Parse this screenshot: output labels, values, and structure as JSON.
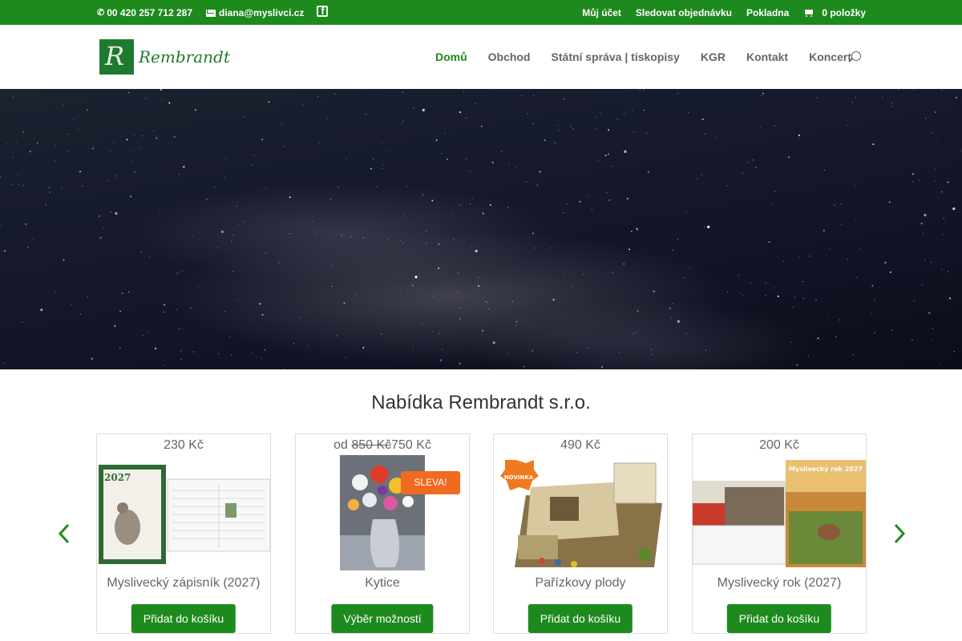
{
  "topbar": {
    "phone": "00 420 257 712 287",
    "email": "diana@myslivci.cz",
    "links": [
      "Můj účet",
      "Sledovat objednávku",
      "Pokladna"
    ],
    "cart": "0 položky"
  },
  "header": {
    "logo_text": "Rembrandt",
    "nav": [
      "Domů",
      "Obchod",
      "Státní správa | tiskopisy",
      "KGR",
      "Kontakt",
      "Koncert"
    ]
  },
  "section": {
    "title": "Nabídka Rembrandt s.r.o."
  },
  "products": [
    {
      "price": "230 Kč",
      "name": "Myslivecký zápisník (2027)",
      "button": "Přidat do košíku",
      "image": "notebook-calendar-image",
      "cover_year": "2027"
    },
    {
      "price_prefix": "od ",
      "price_old": "850 Kč",
      "price_new": "750 Kč",
      "name": "Kytice",
      "button": "Výběr možností",
      "badge": "SLEVA!",
      "image": "flower-painting-image"
    },
    {
      "price": "490 Kč",
      "name": "Pařízkovy plody",
      "button": "Přidat do košíku",
      "badge": "NOVINKA",
      "image": "board-game-image"
    },
    {
      "price": "200 Kč",
      "name": "Myslivecký rok (2027)",
      "button": "Přidat do košíku",
      "image": "wildlife-calendar-image"
    }
  ],
  "colors": {
    "brand_green": "#1e8a1e",
    "sale_orange": "#f06a20"
  }
}
